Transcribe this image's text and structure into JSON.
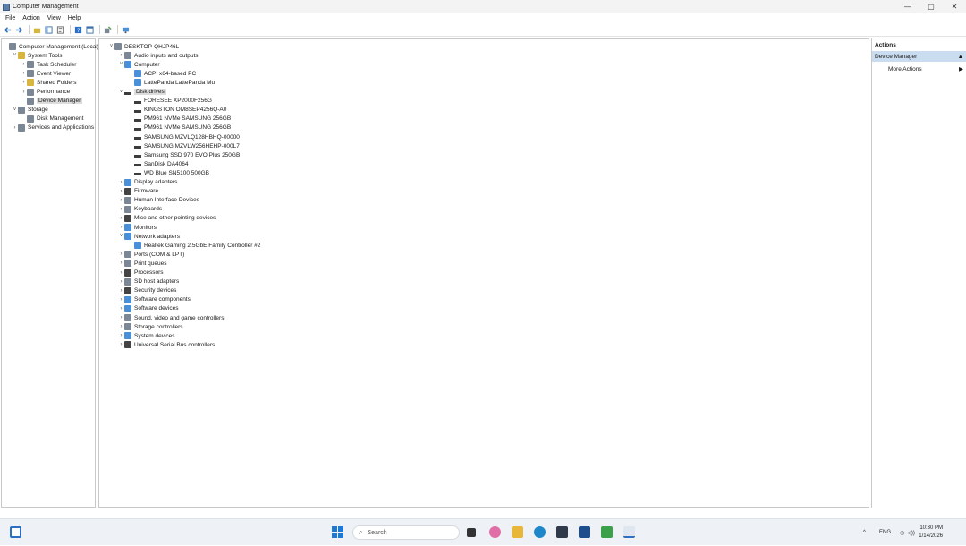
{
  "window": {
    "title": "Computer Management",
    "controls": {
      "minimize": "—",
      "maximize": "▢",
      "close": "✕"
    }
  },
  "menu": [
    "File",
    "Action",
    "View",
    "Help"
  ],
  "left_tree": [
    {
      "label": "Computer Management (Local)",
      "level": 0,
      "chevron": "",
      "icon": "gray"
    },
    {
      "label": "System Tools",
      "level": 1,
      "chevron": "˅",
      "icon": "yellow"
    },
    {
      "label": "Task Scheduler",
      "level": 2,
      "chevron": "›",
      "icon": "gray"
    },
    {
      "label": "Event Viewer",
      "level": 2,
      "chevron": "›",
      "icon": "gray"
    },
    {
      "label": "Shared Folders",
      "level": 2,
      "chevron": "›",
      "icon": "yellow"
    },
    {
      "label": "Performance",
      "level": 2,
      "chevron": "›",
      "icon": "gray"
    },
    {
      "label": "Device Manager",
      "level": 2,
      "chevron": "",
      "icon": "gray",
      "selected": true
    },
    {
      "label": "Storage",
      "level": 1,
      "chevron": "˅",
      "icon": "gray"
    },
    {
      "label": "Disk Management",
      "level": 2,
      "chevron": "",
      "icon": "gray"
    },
    {
      "label": "Services and Applications",
      "level": 1,
      "chevron": "›",
      "icon": "gray"
    }
  ],
  "device_tree": [
    {
      "label": "DESKTOP-QHJP46L",
      "level": 0,
      "chevron": "˅",
      "icon": "gray"
    },
    {
      "label": "Audio inputs and outputs",
      "level": 1,
      "chevron": "›",
      "icon": "gray"
    },
    {
      "label": "Computer",
      "level": 1,
      "chevron": "˅",
      "icon": "blue"
    },
    {
      "label": "ACPI x64-based PC",
      "level": 2,
      "chevron": "",
      "icon": "blue"
    },
    {
      "label": "LattePanda LattePanda Mu",
      "level": 2,
      "chevron": "",
      "icon": "blue"
    },
    {
      "label": "Disk drives",
      "level": 1,
      "chevron": "˅",
      "icon": "drive",
      "selected": true
    },
    {
      "label": "FORESEE XP2000F256G",
      "level": 2,
      "chevron": "",
      "icon": "drive"
    },
    {
      "label": "KINGSTON OM8SEP4256Q-A0",
      "level": 2,
      "chevron": "",
      "icon": "drive"
    },
    {
      "label": "PM961 NVMe SAMSUNG 256GB",
      "level": 2,
      "chevron": "",
      "icon": "drive"
    },
    {
      "label": "PM961 NVMe SAMSUNG 256GB",
      "level": 2,
      "chevron": "",
      "icon": "drive"
    },
    {
      "label": "SAMSUNG MZVLQ128HBHQ-00000",
      "level": 2,
      "chevron": "",
      "icon": "drive"
    },
    {
      "label": "SAMSUNG MZVLW256HEHP-000L7",
      "level": 2,
      "chevron": "",
      "icon": "drive"
    },
    {
      "label": "Samsung SSD 970 EVO Plus 250GB",
      "level": 2,
      "chevron": "",
      "icon": "drive"
    },
    {
      "label": "SanDisk DA4064",
      "level": 2,
      "chevron": "",
      "icon": "drive"
    },
    {
      "label": "WD Blue SN5100 500GB",
      "level": 2,
      "chevron": "",
      "icon": "drive"
    },
    {
      "label": "Display adapters",
      "level": 1,
      "chevron": "›",
      "icon": "blue"
    },
    {
      "label": "Firmware",
      "level": 1,
      "chevron": "›",
      "icon": "dark"
    },
    {
      "label": "Human Interface Devices",
      "level": 1,
      "chevron": "›",
      "icon": "gray"
    },
    {
      "label": "Keyboards",
      "level": 1,
      "chevron": "›",
      "icon": "gray"
    },
    {
      "label": "Mice and other pointing devices",
      "level": 1,
      "chevron": "›",
      "icon": "dark"
    },
    {
      "label": "Monitors",
      "level": 1,
      "chevron": "›",
      "icon": "blue"
    },
    {
      "label": "Network adapters",
      "level": 1,
      "chevron": "˅",
      "icon": "blue"
    },
    {
      "label": "Realtek Gaming 2.5GbE Family Controller #2",
      "level": 2,
      "chevron": "",
      "icon": "blue"
    },
    {
      "label": "Ports (COM & LPT)",
      "level": 1,
      "chevron": "›",
      "icon": "gray"
    },
    {
      "label": "Print queues",
      "level": 1,
      "chevron": "›",
      "icon": "gray"
    },
    {
      "label": "Processors",
      "level": 1,
      "chevron": "›",
      "icon": "dark"
    },
    {
      "label": "SD host adapters",
      "level": 1,
      "chevron": "›",
      "icon": "gray"
    },
    {
      "label": "Security devices",
      "level": 1,
      "chevron": "›",
      "icon": "dark"
    },
    {
      "label": "Software components",
      "level": 1,
      "chevron": "›",
      "icon": "blue"
    },
    {
      "label": "Software devices",
      "level": 1,
      "chevron": "›",
      "icon": "blue"
    },
    {
      "label": "Sound, video and game controllers",
      "level": 1,
      "chevron": "›",
      "icon": "gray"
    },
    {
      "label": "Storage controllers",
      "level": 1,
      "chevron": "›",
      "icon": "gray"
    },
    {
      "label": "System devices",
      "level": 1,
      "chevron": "›",
      "icon": "blue"
    },
    {
      "label": "Universal Serial Bus controllers",
      "level": 1,
      "chevron": "›",
      "icon": "dark"
    }
  ],
  "actions": {
    "header": "Actions",
    "section": "Device Manager",
    "section_arrow": "▲",
    "more": "More Actions",
    "more_arrow": "▶"
  },
  "taskbar": {
    "search_placeholder": "Search",
    "tray_lang": "ENG",
    "time": "10:30 PM",
    "date": "1/14/2026",
    "tray_chevron": "^"
  }
}
